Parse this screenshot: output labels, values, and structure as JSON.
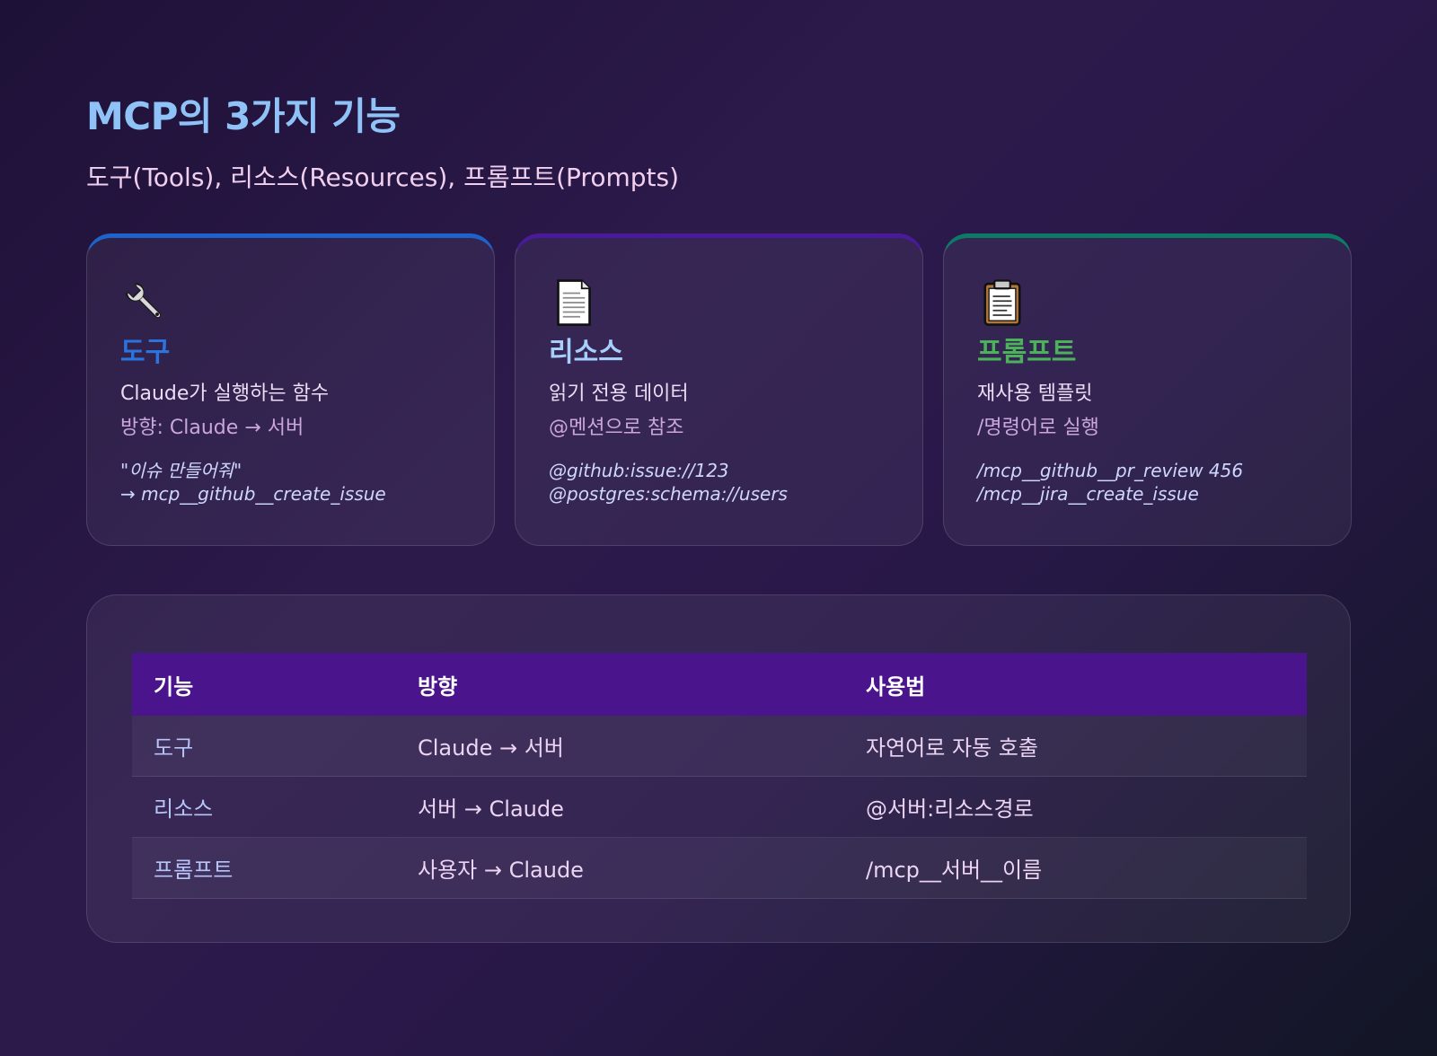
{
  "header": {
    "title": "MCP의 3가지 기능",
    "subtitle": "도구(Tools), 리소스(Resources), 프롬프트(Prompts)"
  },
  "cards": [
    {
      "icon": "wrench-icon",
      "title": "도구",
      "description": "Claude가 실행하는 함수",
      "detail": "방향: Claude → 서버",
      "example_lines": [
        "\"이슈 만들어줘\"",
        "→ mcp__github__create_issue"
      ],
      "accent": "#1e63cc",
      "title_color": "#2b74de"
    },
    {
      "icon": "document-icon",
      "title": "리소스",
      "description": "읽기 전용 데이터",
      "detail": "@멘션으로 참조",
      "example_lines": [
        "@github:issue://123",
        "@postgres:schema://users"
      ],
      "accent": "#4a1a9c",
      "title_color": "#a6d0fb"
    },
    {
      "icon": "clipboard-icon",
      "title": "프롬프트",
      "description": "재사용 템플릿",
      "detail": "/명령어로 실행",
      "example_lines": [
        "/mcp__github__pr_review 456",
        "/mcp__jira__create_issue"
      ],
      "accent": "#0d7a66",
      "title_color": "#4cb25a"
    }
  ],
  "table": {
    "headers": [
      "기능",
      "방향",
      "사용법"
    ],
    "rows": [
      [
        "도구",
        "Claude → 서버",
        "자연어로 자동 호출"
      ],
      [
        "리소스",
        "서버 → Claude",
        "@서버:리소스경로"
      ],
      [
        "프롬프트",
        "사용자 → Claude",
        "/mcp__서버__이름"
      ]
    ],
    "header_color": "#4a148c"
  }
}
